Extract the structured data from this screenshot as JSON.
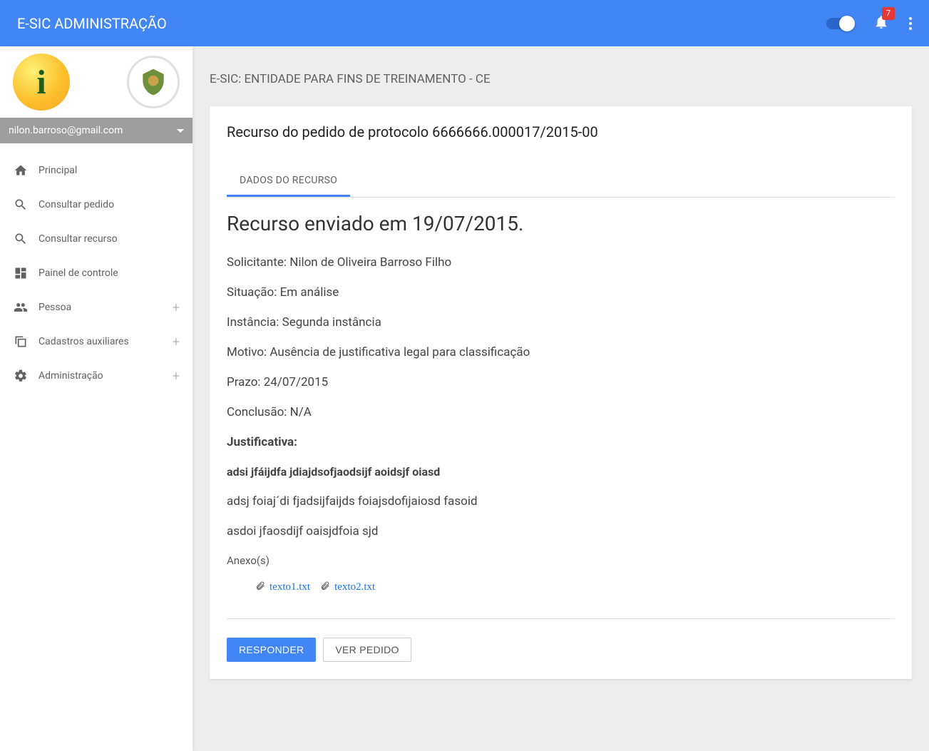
{
  "topbar": {
    "title": "E-SIC ADMINISTRAÇÃO",
    "notification_count": "7"
  },
  "user": {
    "email": "nilon.barroso@gmail.com"
  },
  "sidebar": {
    "items": [
      {
        "label": "Principal",
        "icon": "home"
      },
      {
        "label": "Consultar pedido",
        "icon": "search-doc"
      },
      {
        "label": "Consultar recurso",
        "icon": "search-doc"
      },
      {
        "label": "Painel de controle",
        "icon": "dashboard"
      },
      {
        "label": "Pessoa",
        "icon": "people",
        "expandable": true
      },
      {
        "label": "Cadastros auxiliares",
        "icon": "copy",
        "expandable": true
      },
      {
        "label": "Administração",
        "icon": "gear",
        "expandable": true
      }
    ]
  },
  "page": {
    "context": "E-SIC: ENTIDADE PARA FINS DE TREINAMENTO - CE",
    "card_title": "Recurso do pedido de protocolo 6666666.000017/2015-00",
    "tab_label": "DADOS DO RECURSO",
    "heading": "Recurso enviado em 19/07/2015.",
    "details": {
      "solicitante": "Solicitante: Nilon de Oliveira Barroso Filho",
      "situacao": "Situação: Em análise",
      "instancia": "Instância: Segunda instância",
      "motivo": "Motivo: Ausência de justificativa legal para classificação",
      "prazo": "Prazo: 24/07/2015",
      "conclusao": "Conclusão: N/A",
      "justificativa_label": "Justificativa:",
      "just_line1": "adsi jfáijdfa jdiajdsofjaodsijf aoidsjf oiasd",
      "just_line2": "adsj foiaj´di fjadsijfaijds foiajsdofijaiosd fasoid",
      "just_line3": "asdoi jfaosdijf oaisjdfoia sjd",
      "anexos_label": "Anexo(s)"
    },
    "attachments": [
      {
        "name": "texto1.txt"
      },
      {
        "name": "texto2.txt"
      }
    ],
    "actions": {
      "respond": "RESPONDER",
      "view_request": "VER PEDIDO"
    }
  }
}
